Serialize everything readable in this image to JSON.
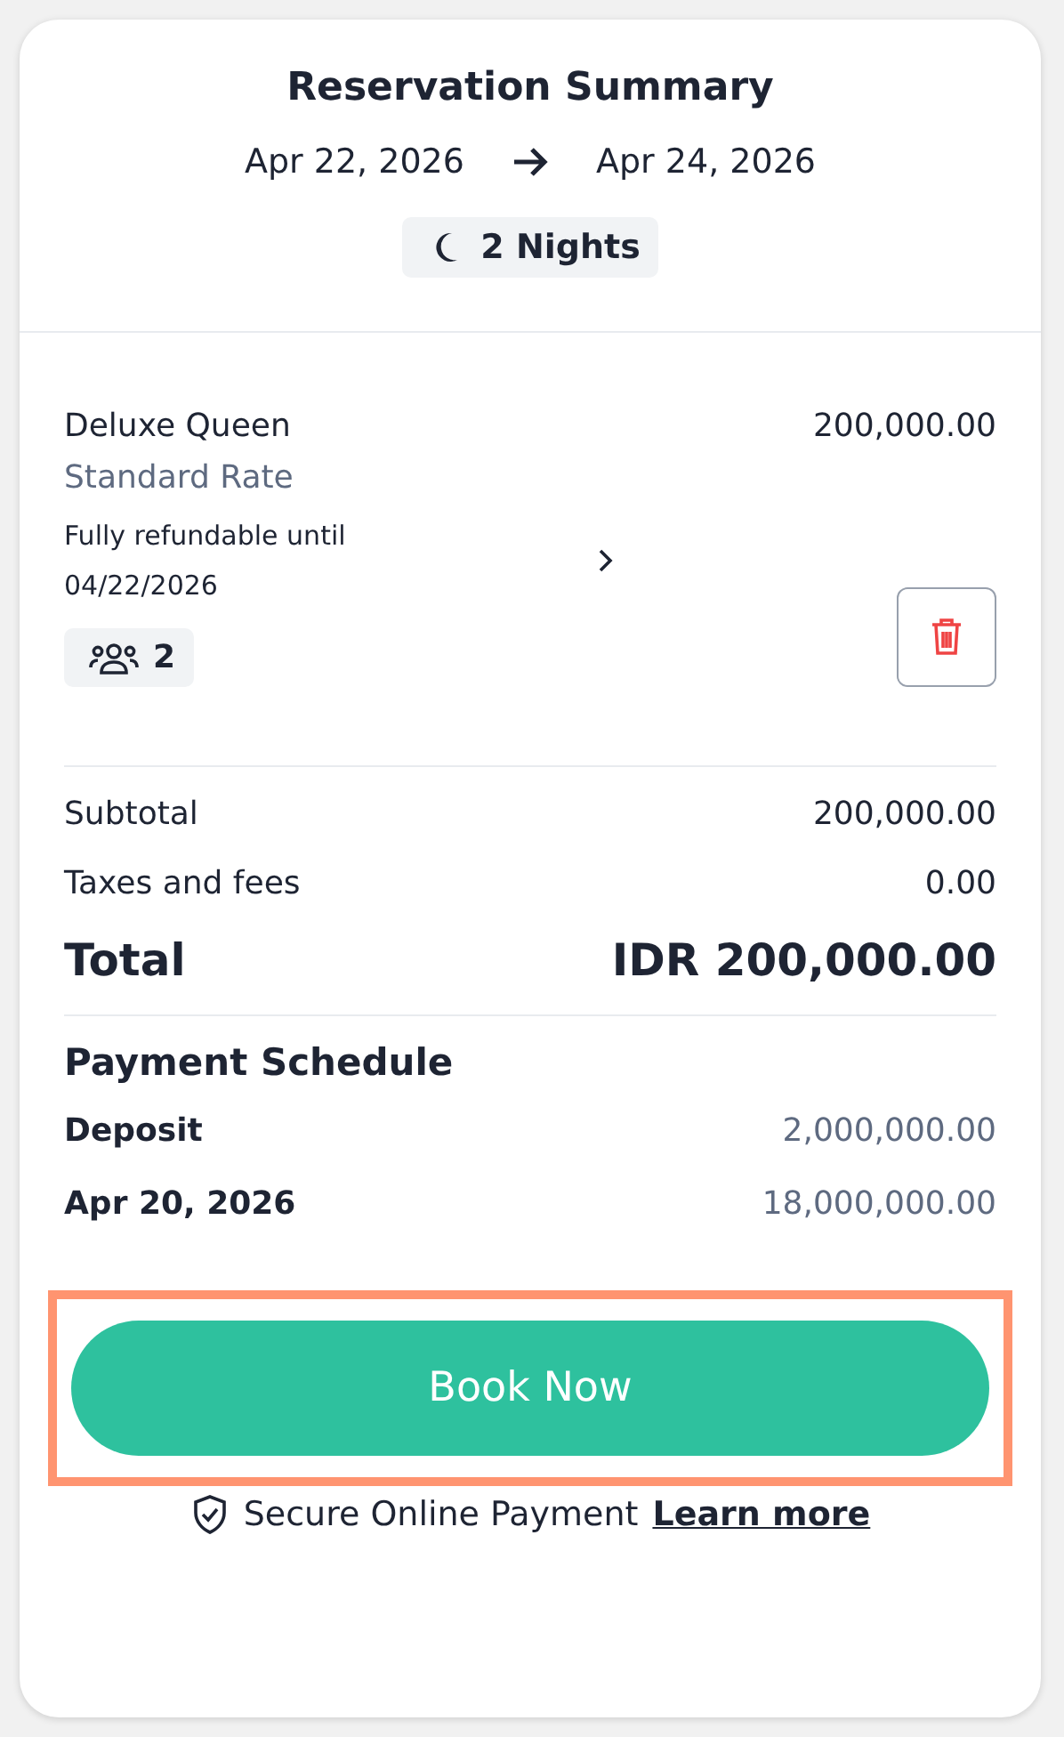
{
  "summary": {
    "title": "Reservation Summary",
    "check_in": "Apr 22, 2026",
    "check_out": "Apr 24, 2026",
    "nights": "2 Nights"
  },
  "room": {
    "name": "Deluxe Queen",
    "price": "200,000.00",
    "rate": "Standard Rate",
    "policy": "Fully refundable until 04/22/2026",
    "guests": "2"
  },
  "totals": [
    {
      "kind": "line",
      "label": "Subtotal",
      "value": "200,000.00"
    },
    {
      "kind": "line",
      "label": "Taxes and fees",
      "value": "0.00"
    },
    {
      "kind": "total",
      "label": "Total",
      "value": "IDR 200,000.00"
    }
  ],
  "payment_schedule": {
    "title": "Payment Schedule",
    "items": [
      {
        "label": "Deposit",
        "amount": "2,000,000.00"
      },
      {
        "label": "Apr 20, 2026",
        "amount": "18,000,000.00"
      }
    ]
  },
  "book_button": {
    "label": "Book Now",
    "highlighted": true
  },
  "footer": {
    "text": "Secure Online Payment",
    "link": "Learn more"
  }
}
